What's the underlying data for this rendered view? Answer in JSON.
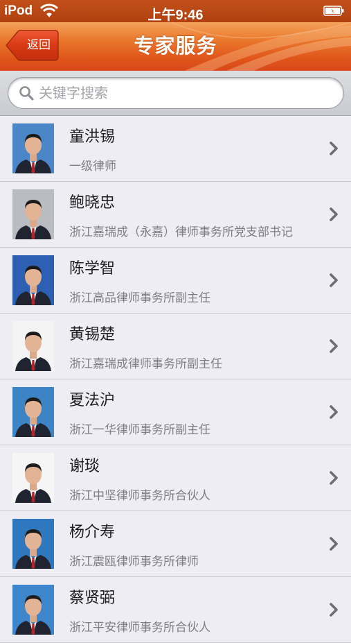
{
  "status_bar": {
    "carrier": "iPod",
    "time": "上午9:46",
    "wifi_icon": "wifi-icon",
    "battery_icon": "battery-charging-icon"
  },
  "nav": {
    "back_label": "返回",
    "title": "专家服务",
    "colors": {
      "bar": "#e0551a",
      "back_button": "#d83a14"
    }
  },
  "search": {
    "placeholder": "关键字搜索",
    "value": "",
    "icon": "search-icon"
  },
  "experts": [
    {
      "name": "童洪锡",
      "title": "一级律师",
      "bg": "#4a86c8"
    },
    {
      "name": "鲍晓忠",
      "title": "浙江嘉瑞成（永嘉）律师事务所党支部书记",
      "bg": "#b9bcc0"
    },
    {
      "name": "陈学智",
      "title": "浙江高品律师事务所副主任",
      "bg": "#2d5fb3"
    },
    {
      "name": "黄锡楚",
      "title": "浙江嘉瑞成律师事务所副主任",
      "bg": "#f4f4f4"
    },
    {
      "name": "夏法沪",
      "title": "浙江一华律师事务所副主任",
      "bg": "#3d84c6"
    },
    {
      "name": "谢琰",
      "title": "浙江中坚律师事务所合伙人",
      "bg": "#f5f5f5"
    },
    {
      "name": "杨介寿",
      "title": "浙江震瓯律师事务所律师",
      "bg": "#2f78c0"
    },
    {
      "name": "蔡贤弼",
      "title": "浙江平安律师事务所合伙人",
      "bg": "#3e86cc"
    }
  ],
  "row_icon": "chevron-right-icon"
}
